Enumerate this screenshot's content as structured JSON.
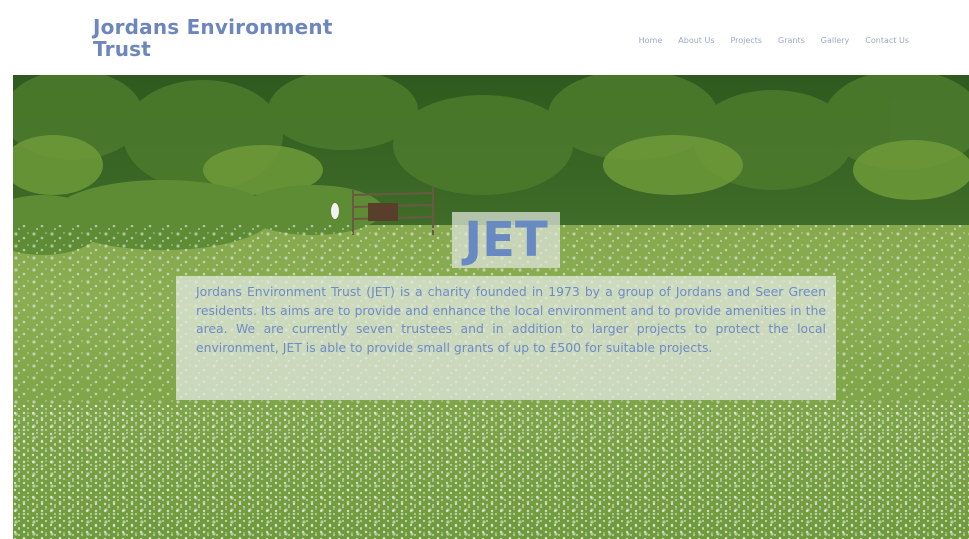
{
  "header": {
    "site_title": "Jordans Environment Trust",
    "nav": [
      "Home",
      "About Us",
      "Projects",
      "Grants",
      "Gallery",
      "Contact Us"
    ]
  },
  "hero": {
    "badge": "JET",
    "intro": "Jordans Environment Trust (JET) is a charity founded in 1973 by a group of Jordans and Seer Green residents. Its aims are to provide and enhance the local environment and to provide amenities in the area. We are currently seven trustees and in addition to larger projects to protect the local environment, JET is able to provide small grants of up to £500 for suitable projects."
  },
  "colors": {
    "accent": "#6d86be",
    "nav_text": "#9da9c4",
    "overlay": "#e4e9e2"
  }
}
